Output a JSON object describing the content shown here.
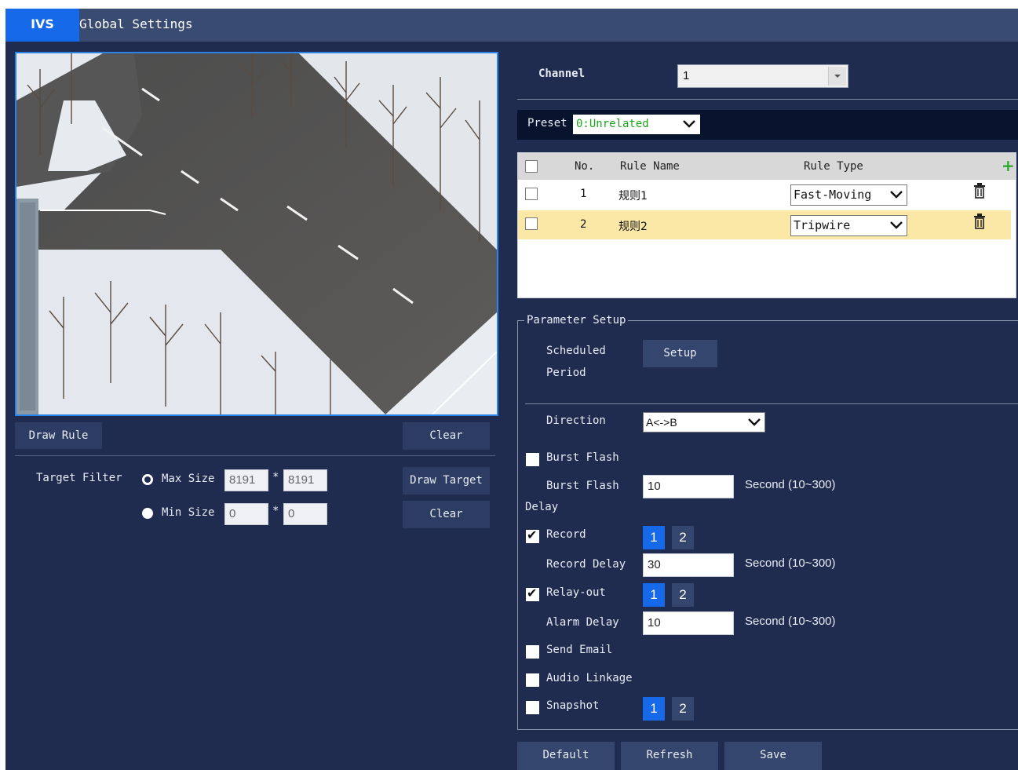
{
  "tabs": {
    "active": "IVS",
    "other": "Global Settings"
  },
  "left": {
    "draw_rule_label": "Draw Rule",
    "clear_label": "Clear",
    "target_filter_label": "Target Filter",
    "max_size_label": "Max Size",
    "min_size_label": "Min Size",
    "max_w": "8191",
    "max_h": "8191",
    "min_w": "0",
    "min_h": "0",
    "times": "*",
    "draw_target_label": "Draw Target",
    "clear2_label": "Clear"
  },
  "channel": {
    "label": "Channel",
    "value": "1"
  },
  "preset": {
    "label": "Preset",
    "value": "0:Unrelated"
  },
  "rules_table": {
    "headers": {
      "no": "No.",
      "name": "Rule Name",
      "type": "Rule Type"
    },
    "rows": [
      {
        "no": "1",
        "name": "规则1",
        "type": "Fast-Moving",
        "selected": false
      },
      {
        "no": "2",
        "name": "规则2",
        "type": "Tripwire",
        "selected": true
      }
    ]
  },
  "param": {
    "legend": "Parameter Setup",
    "scheduled_line1": "Scheduled",
    "scheduled_line2": "Period",
    "setup_label": "Setup",
    "direction_label": "Direction",
    "direction_value": "A<->B",
    "burst_flash_label": "Burst Flash",
    "burst_flash_delay_line1": "Burst Flash",
    "burst_flash_delay_line2": "Delay",
    "burst_flash_delay_value": "10",
    "record_label": "Record",
    "record_delay_label": "Record Delay",
    "record_delay_value": "30",
    "relay_out_label": "Relay-out",
    "alarm_delay_label": "Alarm Delay",
    "alarm_delay_value": "10",
    "send_email_label": "Send Email",
    "audio_linkage_label": "Audio Linkage",
    "snapshot_label": "Snapshot",
    "second_hint": "Second (10~300)",
    "channel_1": "1",
    "channel_2": "2"
  },
  "footer": {
    "default_label": "Default",
    "refresh_label": "Refresh",
    "save_label": "Save"
  },
  "colors": {
    "background": "#1f2b4f",
    "tabbar": "#3a4b72",
    "accent": "#1669e8",
    "selected_row": "#fbe7a6",
    "preset_text": "#1aa51a"
  }
}
